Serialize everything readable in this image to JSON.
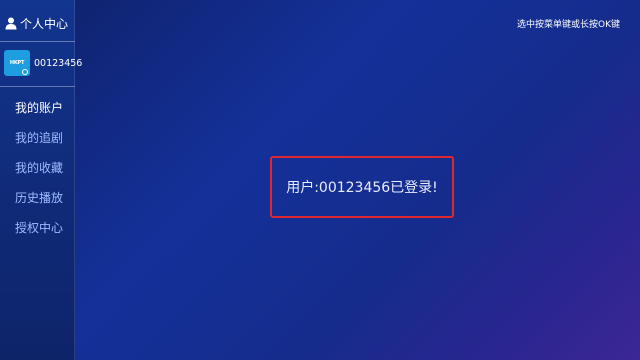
{
  "sidebar": {
    "title": "个人中心",
    "user_id": "00123456",
    "avatar_text": "HKPT",
    "items": [
      {
        "label": "我的账户",
        "active": true
      },
      {
        "label": "我的追剧",
        "active": false
      },
      {
        "label": "我的收藏",
        "active": false
      },
      {
        "label": "历史播放",
        "active": false
      },
      {
        "label": "授权中心",
        "active": false
      }
    ]
  },
  "hint": "选中按菜单键或长按OK键",
  "main": {
    "message": "用户:00123456已登录!"
  },
  "colors": {
    "highlight_border": "#e0262e",
    "menu_inactive": "#9fbcff",
    "avatar_bg": "#1e9ee0"
  },
  "icons": {
    "title_icon": "person-icon",
    "avatar_badge": "settings-dot-icon"
  }
}
